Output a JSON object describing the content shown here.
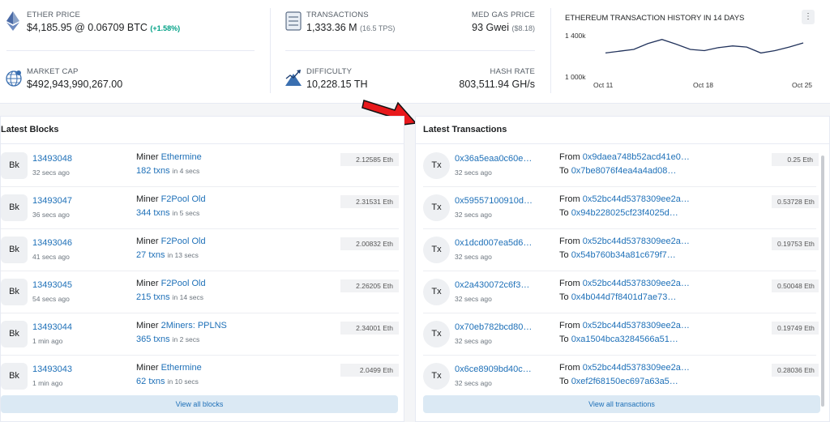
{
  "stats": {
    "ether_price": {
      "label": "ETHER PRICE",
      "value": "$4,185.95",
      "btc": "@ 0.06709 BTC",
      "change": "(+1.58%)"
    },
    "market_cap": {
      "label": "MARKET CAP",
      "value": "$492,943,990,267.00"
    },
    "transactions": {
      "label": "TRANSACTIONS",
      "value": "1,333.36 M",
      "tps": "(16.5 TPS)"
    },
    "med_gas": {
      "label": "MED GAS PRICE",
      "value": "93 Gwei",
      "usd": "($8.18)"
    },
    "difficulty": {
      "label": "DIFFICULTY",
      "value": "10,228.15 TH"
    },
    "hash_rate": {
      "label": "HASH RATE",
      "value": "803,511.94 GH/s"
    }
  },
  "chart": {
    "title": "ETHEREUM TRANSACTION HISTORY IN 14 DAYS",
    "menu_glyph": "⋮",
    "y_ticks": [
      "1 400k",
      "1 000k"
    ],
    "x_ticks": [
      "Oct 11",
      "Oct 18",
      "Oct 25"
    ]
  },
  "chart_data": {
    "type": "line",
    "title": "ETHEREUM TRANSACTION HISTORY IN 14 DAYS",
    "x": [
      "Oct 11",
      "Oct 12",
      "Oct 13",
      "Oct 14",
      "Oct 15",
      "Oct 16",
      "Oct 17",
      "Oct 18",
      "Oct 19",
      "Oct 20",
      "Oct 21",
      "Oct 22",
      "Oct 23",
      "Oct 24",
      "Oct 25"
    ],
    "series": [
      {
        "values": [
          1225,
          1240,
          1255,
          1305,
          1340,
          1300,
          1255,
          1245,
          1270,
          1285,
          1275,
          1225,
          1245,
          1275,
          1310
        ]
      }
    ],
    "xlabel": "",
    "ylabel": "",
    "ylim": [
      1000,
      1400
    ],
    "y_unit_note": "thousands"
  },
  "latest_blocks": {
    "title": "Latest Blocks",
    "badge": "Bk",
    "miner_prefix": "Miner",
    "txns_word": "txns",
    "items": [
      {
        "number": "13493048",
        "age": "32 secs ago",
        "miner": "Ethermine",
        "txns": "182",
        "in": "in 4 secs",
        "reward": "2.12585 Eth"
      },
      {
        "number": "13493047",
        "age": "36 secs ago",
        "miner": "F2Pool Old",
        "txns": "344",
        "in": "in 5 secs",
        "reward": "2.31531 Eth"
      },
      {
        "number": "13493046",
        "age": "41 secs ago",
        "miner": "F2Pool Old",
        "txns": "27",
        "in": "in 13 secs",
        "reward": "2.00832 Eth"
      },
      {
        "number": "13493045",
        "age": "54 secs ago",
        "miner": "F2Pool Old",
        "txns": "215",
        "in": "in 14 secs",
        "reward": "2.26205 Eth"
      },
      {
        "number": "13493044",
        "age": "1 min ago",
        "miner": "2Miners: PPLNS",
        "txns": "365",
        "in": "in 2 secs",
        "reward": "2.34001 Eth"
      },
      {
        "number": "13493043",
        "age": "1 min ago",
        "miner": "Ethermine",
        "txns": "62",
        "in": "in 10 secs",
        "reward": "2.0499 Eth"
      }
    ],
    "view_all": "View all blocks"
  },
  "latest_transactions": {
    "title": "Latest Transactions",
    "badge": "Tx",
    "from_word": "From",
    "to_word": "To",
    "items": [
      {
        "hash": "0x36a5eaa0c60e…",
        "age": "32 secs ago",
        "from": "0x9daea748b52acd41e0…",
        "to": "0x7be8076f4ea4a4ad08…",
        "value": "0.25 Eth"
      },
      {
        "hash": "0x59557100910d…",
        "age": "32 secs ago",
        "from": "0x52bc44d5378309ee2a…",
        "to": "0x94b228025cf23f4025d…",
        "value": "0.53728 Eth"
      },
      {
        "hash": "0x1dcd007ea5d6…",
        "age": "32 secs ago",
        "from": "0x52bc44d5378309ee2a…",
        "to": "0x54b760b34a81c679f7…",
        "value": "0.19753 Eth"
      },
      {
        "hash": "0x2a430072c6f3…",
        "age": "32 secs ago",
        "from": "0x52bc44d5378309ee2a…",
        "to": "0x4b044d7f8401d7ae73…",
        "value": "0.50048 Eth"
      },
      {
        "hash": "0x70eb782bcd80…",
        "age": "32 secs ago",
        "from": "0x52bc44d5378309ee2a…",
        "to": "0xa1504bca3284566a51…",
        "value": "0.19749 Eth"
      },
      {
        "hash": "0x6ce8909bd40c…",
        "age": "32 secs ago",
        "from": "0x52bc44d5378309ee2a…",
        "to": "0xef2f68150ec697a63a5…",
        "value": "0.28036 Eth"
      }
    ],
    "view_all": "View all transactions"
  },
  "colors": {
    "link": "#1e70b8",
    "green": "#00a186",
    "annotation_arrow": "#e8191c"
  }
}
